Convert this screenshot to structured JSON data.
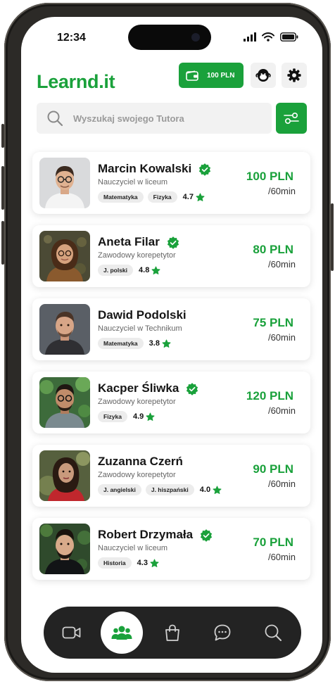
{
  "status_bar": {
    "time": "12:34"
  },
  "app": {
    "logo": "Learnd.it"
  },
  "header": {
    "wallet_label": "100 PLN"
  },
  "search": {
    "placeholder": "Wyszukaj swojego Tutora"
  },
  "tutors": [
    {
      "name": "Marcin Kowalski",
      "role": "Nauczyciel w liceum",
      "subjects": [
        "Matematyka",
        "Fizyka"
      ],
      "rating": "4.7",
      "price": "100 PLN",
      "per": "/60min"
    },
    {
      "name": "Aneta Filar",
      "role": "Zawodowy korepetytor",
      "subjects": [
        "J. polski"
      ],
      "rating": "4.8",
      "price": "80 PLN",
      "per": "/60min"
    },
    {
      "name": "Dawid Podolski",
      "role": "Nauczyciel w Technikum",
      "subjects": [
        "Matematyka"
      ],
      "rating": "3.8",
      "price": "75 PLN",
      "per": "/60min"
    },
    {
      "name": "Kacper Śliwka",
      "role": "Zawodowy korepetytor",
      "subjects": [
        "Fizyka"
      ],
      "rating": "4.9",
      "price": "120 PLN",
      "per": "/60min"
    },
    {
      "name": "Zuzanna Czerń",
      "role": "Zawodowy korepetytor",
      "subjects": [
        "J. angielski",
        "J. hiszpański"
      ],
      "rating": "4.0",
      "price": "90 PLN",
      "per": "/60min"
    },
    {
      "name": "Robert Drzymała",
      "role": "Nauczyciel w liceum",
      "subjects": [
        "Historia"
      ],
      "rating": "4.3",
      "price": "70 PLN",
      "per": "/60min"
    }
  ],
  "bottom_nav": [
    {
      "icon": "video-icon",
      "active": false
    },
    {
      "icon": "users-icon",
      "active": true
    },
    {
      "icon": "shopping-bag-icon",
      "active": false
    },
    {
      "icon": "chat-icon",
      "active": false
    },
    {
      "icon": "search-icon",
      "active": false
    }
  ],
  "colors": {
    "accent": "#1aa13b",
    "nav_bg": "#232323",
    "card_bg": "#ffffff"
  }
}
